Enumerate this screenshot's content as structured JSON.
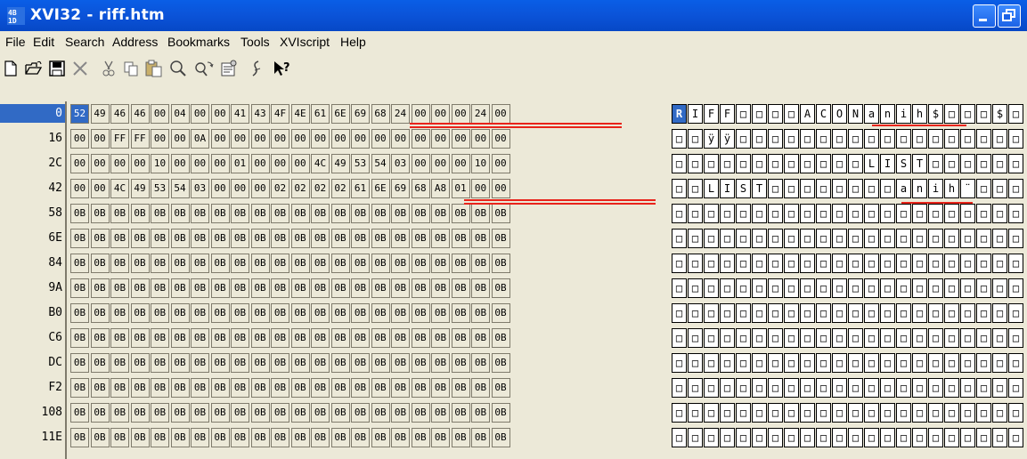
{
  "window": {
    "title": "XVI32 - riff.htm",
    "colors": {
      "title_bar": "#0b53d8",
      "selection": "#316ac5",
      "annotation": "#e8231a",
      "chrome": "#ece9d8"
    }
  },
  "menu": [
    "File",
    "Edit",
    "Search",
    "Address",
    "Bookmarks",
    "Tools",
    "XVIscript",
    "Help"
  ],
  "toolbar": [
    {
      "name": "new-icon"
    },
    {
      "name": "open-icon"
    },
    {
      "name": "save-icon"
    },
    {
      "name": "delete-icon"
    },
    {
      "name": "cut-icon"
    },
    {
      "name": "copy-icon"
    },
    {
      "name": "paste-icon"
    },
    {
      "name": "find-icon"
    },
    {
      "name": "replace-icon"
    },
    {
      "name": "properties-icon"
    },
    {
      "name": "script-icon"
    },
    {
      "name": "help-icon"
    }
  ],
  "rows": [
    {
      "addr": "0",
      "hex": [
        "52",
        "49",
        "46",
        "46",
        "00",
        "04",
        "00",
        "00",
        "41",
        "43",
        "4F",
        "4E",
        "61",
        "6E",
        "69",
        "68",
        "24",
        "00",
        "00",
        "00",
        "24",
        "00"
      ],
      "text": [
        "R",
        "I",
        "F",
        "F",
        "□",
        "□",
        "□",
        "□",
        "A",
        "C",
        "O",
        "N",
        "a",
        "n",
        "i",
        "h",
        "$",
        "□",
        "□",
        "□",
        "$",
        "□"
      ]
    },
    {
      "addr": "16",
      "hex": [
        "00",
        "00",
        "FF",
        "FF",
        "00",
        "00",
        "0A",
        "00",
        "00",
        "00",
        "00",
        "00",
        "00",
        "00",
        "00",
        "00",
        "00",
        "00",
        "00",
        "00",
        "00",
        "00"
      ],
      "text": [
        "□",
        "□",
        "ÿ",
        "ÿ",
        "□",
        "□",
        "□",
        "□",
        "□",
        "□",
        "□",
        "□",
        "□",
        "□",
        "□",
        "□",
        "□",
        "□",
        "□",
        "□",
        "□",
        "□"
      ]
    },
    {
      "addr": "2C",
      "hex": [
        "00",
        "00",
        "00",
        "00",
        "10",
        "00",
        "00",
        "00",
        "01",
        "00",
        "00",
        "00",
        "4C",
        "49",
        "53",
        "54",
        "03",
        "00",
        "00",
        "00",
        "10",
        "00"
      ],
      "text": [
        "□",
        "□",
        "□",
        "□",
        "□",
        "□",
        "□",
        "□",
        "□",
        "□",
        "□",
        "□",
        "L",
        "I",
        "S",
        "T",
        "□",
        "□",
        "□",
        "□",
        "□",
        "□"
      ]
    },
    {
      "addr": "42",
      "hex": [
        "00",
        "00",
        "4C",
        "49",
        "53",
        "54",
        "03",
        "00",
        "00",
        "00",
        "02",
        "02",
        "02",
        "02",
        "61",
        "6E",
        "69",
        "68",
        "A8",
        "01",
        "00",
        "00"
      ],
      "text": [
        "□",
        "□",
        "L",
        "I",
        "S",
        "T",
        "□",
        "□",
        "□",
        "□",
        "□",
        "□",
        "□",
        "□",
        "a",
        "n",
        "i",
        "h",
        "¨",
        "□",
        "□",
        "□"
      ]
    },
    {
      "addr": "58",
      "hex": [
        "0B",
        "0B",
        "0B",
        "0B",
        "0B",
        "0B",
        "0B",
        "0B",
        "0B",
        "0B",
        "0B",
        "0B",
        "0B",
        "0B",
        "0B",
        "0B",
        "0B",
        "0B",
        "0B",
        "0B",
        "0B",
        "0B"
      ],
      "text": [
        "□",
        "□",
        "□",
        "□",
        "□",
        "□",
        "□",
        "□",
        "□",
        "□",
        "□",
        "□",
        "□",
        "□",
        "□",
        "□",
        "□",
        "□",
        "□",
        "□",
        "□",
        "□"
      ]
    },
    {
      "addr": "6E",
      "hex": [
        "0B",
        "0B",
        "0B",
        "0B",
        "0B",
        "0B",
        "0B",
        "0B",
        "0B",
        "0B",
        "0B",
        "0B",
        "0B",
        "0B",
        "0B",
        "0B",
        "0B",
        "0B",
        "0B",
        "0B",
        "0B",
        "0B"
      ],
      "text": [
        "□",
        "□",
        "□",
        "□",
        "□",
        "□",
        "□",
        "□",
        "□",
        "□",
        "□",
        "□",
        "□",
        "□",
        "□",
        "□",
        "□",
        "□",
        "□",
        "□",
        "□",
        "□"
      ]
    },
    {
      "addr": "84",
      "hex": [
        "0B",
        "0B",
        "0B",
        "0B",
        "0B",
        "0B",
        "0B",
        "0B",
        "0B",
        "0B",
        "0B",
        "0B",
        "0B",
        "0B",
        "0B",
        "0B",
        "0B",
        "0B",
        "0B",
        "0B",
        "0B",
        "0B"
      ],
      "text": [
        "□",
        "□",
        "□",
        "□",
        "□",
        "□",
        "□",
        "□",
        "□",
        "□",
        "□",
        "□",
        "□",
        "□",
        "□",
        "□",
        "□",
        "□",
        "□",
        "□",
        "□",
        "□"
      ]
    },
    {
      "addr": "9A",
      "hex": [
        "0B",
        "0B",
        "0B",
        "0B",
        "0B",
        "0B",
        "0B",
        "0B",
        "0B",
        "0B",
        "0B",
        "0B",
        "0B",
        "0B",
        "0B",
        "0B",
        "0B",
        "0B",
        "0B",
        "0B",
        "0B",
        "0B"
      ],
      "text": [
        "□",
        "□",
        "□",
        "□",
        "□",
        "□",
        "□",
        "□",
        "□",
        "□",
        "□",
        "□",
        "□",
        "□",
        "□",
        "□",
        "□",
        "□",
        "□",
        "□",
        "□",
        "□"
      ]
    },
    {
      "addr": "B0",
      "hex": [
        "0B",
        "0B",
        "0B",
        "0B",
        "0B",
        "0B",
        "0B",
        "0B",
        "0B",
        "0B",
        "0B",
        "0B",
        "0B",
        "0B",
        "0B",
        "0B",
        "0B",
        "0B",
        "0B",
        "0B",
        "0B",
        "0B"
      ],
      "text": [
        "□",
        "□",
        "□",
        "□",
        "□",
        "□",
        "□",
        "□",
        "□",
        "□",
        "□",
        "□",
        "□",
        "□",
        "□",
        "□",
        "□",
        "□",
        "□",
        "□",
        "□",
        "□"
      ]
    },
    {
      "addr": "C6",
      "hex": [
        "0B",
        "0B",
        "0B",
        "0B",
        "0B",
        "0B",
        "0B",
        "0B",
        "0B",
        "0B",
        "0B",
        "0B",
        "0B",
        "0B",
        "0B",
        "0B",
        "0B",
        "0B",
        "0B",
        "0B",
        "0B",
        "0B"
      ],
      "text": [
        "□",
        "□",
        "□",
        "□",
        "□",
        "□",
        "□",
        "□",
        "□",
        "□",
        "□",
        "□",
        "□",
        "□",
        "□",
        "□",
        "□",
        "□",
        "□",
        "□",
        "□",
        "□"
      ]
    },
    {
      "addr": "DC",
      "hex": [
        "0B",
        "0B",
        "0B",
        "0B",
        "0B",
        "0B",
        "0B",
        "0B",
        "0B",
        "0B",
        "0B",
        "0B",
        "0B",
        "0B",
        "0B",
        "0B",
        "0B",
        "0B",
        "0B",
        "0B",
        "0B",
        "0B"
      ],
      "text": [
        "□",
        "□",
        "□",
        "□",
        "□",
        "□",
        "□",
        "□",
        "□",
        "□",
        "□",
        "□",
        "□",
        "□",
        "□",
        "□",
        "□",
        "□",
        "□",
        "□",
        "□",
        "□"
      ]
    },
    {
      "addr": "F2",
      "hex": [
        "0B",
        "0B",
        "0B",
        "0B",
        "0B",
        "0B",
        "0B",
        "0B",
        "0B",
        "0B",
        "0B",
        "0B",
        "0B",
        "0B",
        "0B",
        "0B",
        "0B",
        "0B",
        "0B",
        "0B",
        "0B",
        "0B"
      ],
      "text": [
        "□",
        "□",
        "□",
        "□",
        "□",
        "□",
        "□",
        "□",
        "□",
        "□",
        "□",
        "□",
        "□",
        "□",
        "□",
        "□",
        "□",
        "□",
        "□",
        "□",
        "□",
        "□"
      ]
    },
    {
      "addr": "108",
      "hex": [
        "0B",
        "0B",
        "0B",
        "0B",
        "0B",
        "0B",
        "0B",
        "0B",
        "0B",
        "0B",
        "0B",
        "0B",
        "0B",
        "0B",
        "0B",
        "0B",
        "0B",
        "0B",
        "0B",
        "0B",
        "0B",
        "0B"
      ],
      "text": [
        "□",
        "□",
        "□",
        "□",
        "□",
        "□",
        "□",
        "□",
        "□",
        "□",
        "□",
        "□",
        "□",
        "□",
        "□",
        "□",
        "□",
        "□",
        "□",
        "□",
        "□",
        "□"
      ]
    },
    {
      "addr": "11E",
      "hex": [
        "0B",
        "0B",
        "0B",
        "0B",
        "0B",
        "0B",
        "0B",
        "0B",
        "0B",
        "0B",
        "0B",
        "0B",
        "0B",
        "0B",
        "0B",
        "0B",
        "0B",
        "0B",
        "0B",
        "0B",
        "0B",
        "0B"
      ],
      "text": [
        "□",
        "□",
        "□",
        "□",
        "□",
        "□",
        "□",
        "□",
        "□",
        "□",
        "□",
        "□",
        "□",
        "□",
        "□",
        "□",
        "□",
        "□",
        "□",
        "□",
        "□",
        "□"
      ]
    }
  ],
  "selection": {
    "row": 0,
    "col": 0
  }
}
